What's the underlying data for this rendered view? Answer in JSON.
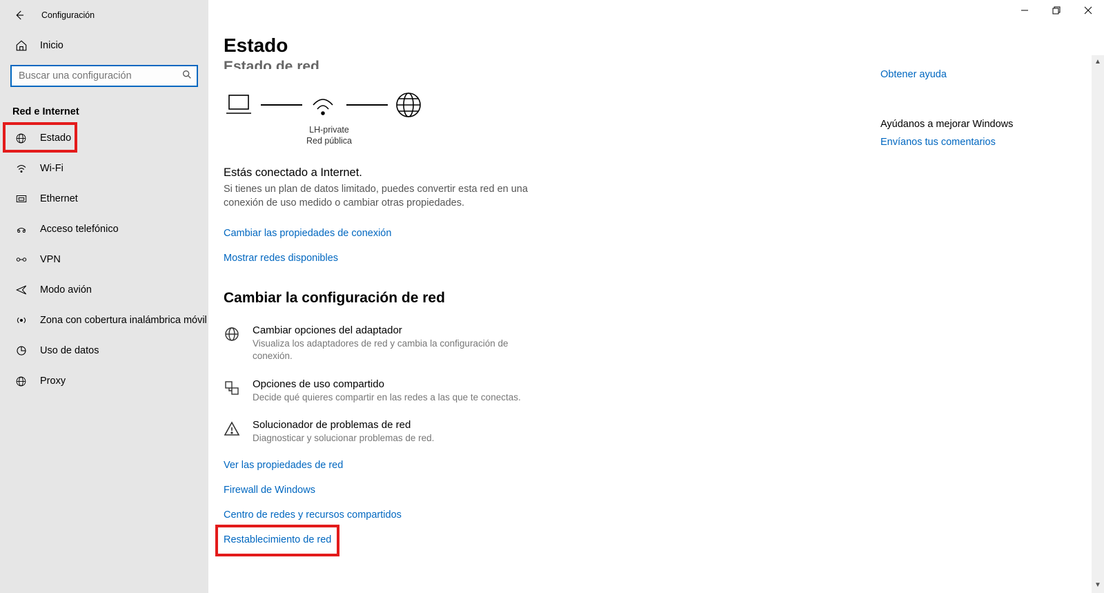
{
  "window": {
    "title": "Configuración"
  },
  "sidebar": {
    "home": "Inicio",
    "search_placeholder": "Buscar una configuración",
    "section": "Red e Internet",
    "items": [
      {
        "id": "status",
        "label": "Estado"
      },
      {
        "id": "wifi",
        "label": "Wi-Fi"
      },
      {
        "id": "ethernet",
        "label": "Ethernet"
      },
      {
        "id": "dialup",
        "label": "Acceso telefónico"
      },
      {
        "id": "vpn",
        "label": "VPN"
      },
      {
        "id": "airplane",
        "label": "Modo avión"
      },
      {
        "id": "hotspot",
        "label": "Zona con cobertura inalámbrica móvil"
      },
      {
        "id": "datausage",
        "label": "Uso de datos"
      },
      {
        "id": "proxy",
        "label": "Proxy"
      }
    ]
  },
  "page": {
    "header": "Estado",
    "cut_header": "Estado de red",
    "diagram": {
      "ssid": "LH-private",
      "net_type": "Red pública"
    },
    "status_title": "Estás conectado a Internet.",
    "status_desc": "Si tienes un plan de datos limitado, puedes convertir esta red en una conexión de uso medido o cambiar otras propiedades.",
    "link_change_props": "Cambiar las propiedades de conexión",
    "link_show_nets": "Mostrar redes disponibles",
    "change_header": "Cambiar la configuración de red",
    "options": [
      {
        "id": "adapter",
        "title": "Cambiar opciones del adaptador",
        "desc": "Visualiza los adaptadores de red y cambia la configuración de conexión."
      },
      {
        "id": "sharing",
        "title": "Opciones de uso compartido",
        "desc": "Decide qué quieres compartir en las redes a las que te conectas."
      },
      {
        "id": "troubleshoot",
        "title": "Solucionador de problemas de red",
        "desc": "Diagnosticar y solucionar problemas de red."
      }
    ],
    "bottom_links": [
      "Ver las propiedades de red",
      "Firewall de Windows",
      "Centro de redes y recursos compartidos",
      "Restablecimiento de red"
    ]
  },
  "right": {
    "get_help": "Obtener ayuda",
    "improve": "Ayúdanos a mejorar Windows",
    "feedback": "Envíanos tus comentarios"
  }
}
